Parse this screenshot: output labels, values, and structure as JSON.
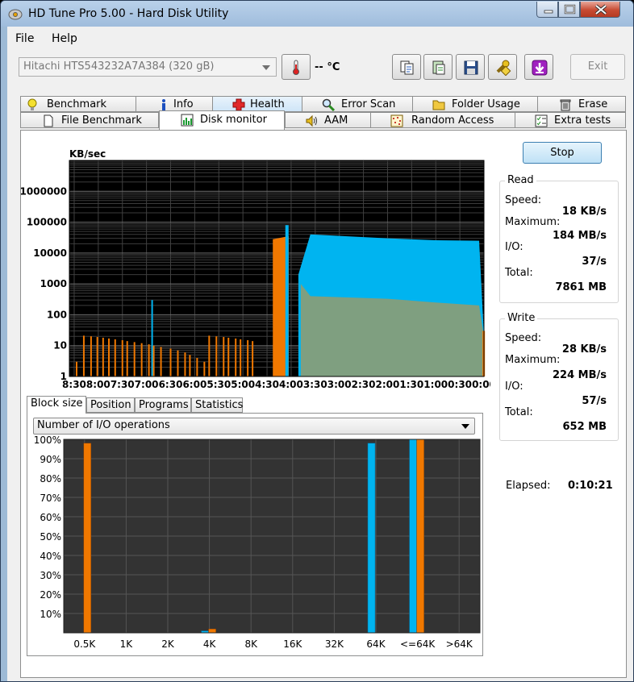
{
  "window": {
    "title": "HD Tune Pro 5.00 - Hard Disk Utility"
  },
  "menu": [
    {
      "label": "File"
    },
    {
      "label": "Help"
    }
  ],
  "toolbar": {
    "drive": "Hitachi HTS543232A7A384  (320 gB)",
    "temperature": "-- °C",
    "exit_label": "Exit"
  },
  "tabs_top": [
    {
      "label": "Benchmark"
    },
    {
      "label": "Info"
    },
    {
      "label": "Health"
    },
    {
      "label": "Error Scan"
    },
    {
      "label": "Folder Usage"
    },
    {
      "label": "Erase"
    }
  ],
  "tabs_bottom": [
    {
      "label": "File Benchmark"
    },
    {
      "label": "Disk monitor"
    },
    {
      "label": "AAM"
    },
    {
      "label": "Random Access"
    },
    {
      "label": "Extra tests"
    }
  ],
  "active_tab": "Disk monitor",
  "stop_label": "Stop",
  "read": {
    "title": "Read",
    "speed_label": "Speed:",
    "speed": "18 KB/s",
    "max_label": "Maximum:",
    "max": "184 MB/s",
    "io_label": "I/O:",
    "io": "37/s",
    "total_label": "Total:",
    "total": "7861 MB"
  },
  "write": {
    "title": "Write",
    "speed_label": "Speed:",
    "speed": "28 KB/s",
    "max_label": "Maximum:",
    "max": "224 MB/s",
    "io_label": "I/O:",
    "io": "57/s",
    "total_label": "Total:",
    "total": "652 MB"
  },
  "elapsed": {
    "label": "Elapsed:",
    "value": "0:10:21"
  },
  "subtabs": [
    {
      "label": "Block size"
    },
    {
      "label": "Position"
    },
    {
      "label": "Programs"
    },
    {
      "label": "Statistics"
    }
  ],
  "metric_select": "Number of I/O operations",
  "colors": {
    "read": "#00b4f0",
    "write": "#f07800",
    "overlap": "#7f9f80",
    "chart_bg": "#000000",
    "lower_bg": "#333333"
  },
  "chart_data": [
    {
      "type": "area",
      "ylabel": "KB/sec",
      "y_scale": "log",
      "ylim": [
        1,
        10000000
      ],
      "y_ticks": [
        "1000000",
        "100000",
        "10000",
        "1000",
        "100",
        "10",
        "1"
      ],
      "x_ticks": [
        "8:30",
        "8:00",
        "7:30",
        "7:00",
        "6:30",
        "6:00",
        "5:30",
        "5:00",
        "4:30",
        "4:00",
        "3:30",
        "3:00",
        "2:30",
        "2:00",
        "1:30",
        "1:00",
        "0:30",
        "0:00"
      ],
      "x_unit": "minutes ago",
      "series": [
        {
          "name": "",
          "role": "read",
          "points": [
            [
              6.9,
              300
            ],
            [
              4.6,
              100
            ],
            [
              4.1,
              80000
            ],
            [
              3.85,
              2000
            ],
            [
              3.6,
              40000
            ],
            [
              3.0,
              36000
            ],
            [
              2.0,
              30000
            ],
            [
              1.0,
              26000
            ],
            [
              0.1,
              25000
            ],
            [
              0.0,
              20
            ]
          ]
        },
        {
          "name": "",
          "role": "write",
          "points": [
            [
              8.5,
              10
            ],
            [
              7.0,
              15
            ],
            [
              5.0,
              8
            ],
            [
              4.35,
              30000
            ],
            [
              4.0,
              40000
            ],
            [
              3.8,
              1000
            ],
            [
              3.6,
              400
            ],
            [
              2.0,
              330
            ],
            [
              1.0,
              250
            ],
            [
              0.1,
              200
            ],
            [
              0.0,
              20
            ]
          ]
        }
      ]
    },
    {
      "type": "bar",
      "categories": [
        "0.5K",
        "1K",
        "2K",
        "4K",
        "8K",
        "16K",
        "32K",
        "64K",
        "<=64K",
        ">64K"
      ],
      "y_ticks": [
        "100%",
        "90%",
        "80%",
        "70%",
        "60%",
        "50%",
        "40%",
        "30%",
        "20%",
        "10%"
      ],
      "ylim": [
        0,
        100
      ],
      "series": [
        {
          "name": "",
          "role": "read",
          "values": [
            0,
            0,
            0,
            1,
            0,
            0,
            0,
            98,
            100,
            0
          ]
        },
        {
          "name": "",
          "role": "write",
          "values": [
            98,
            0,
            0,
            2,
            0,
            0,
            0,
            0,
            100,
            0
          ]
        }
      ]
    }
  ]
}
